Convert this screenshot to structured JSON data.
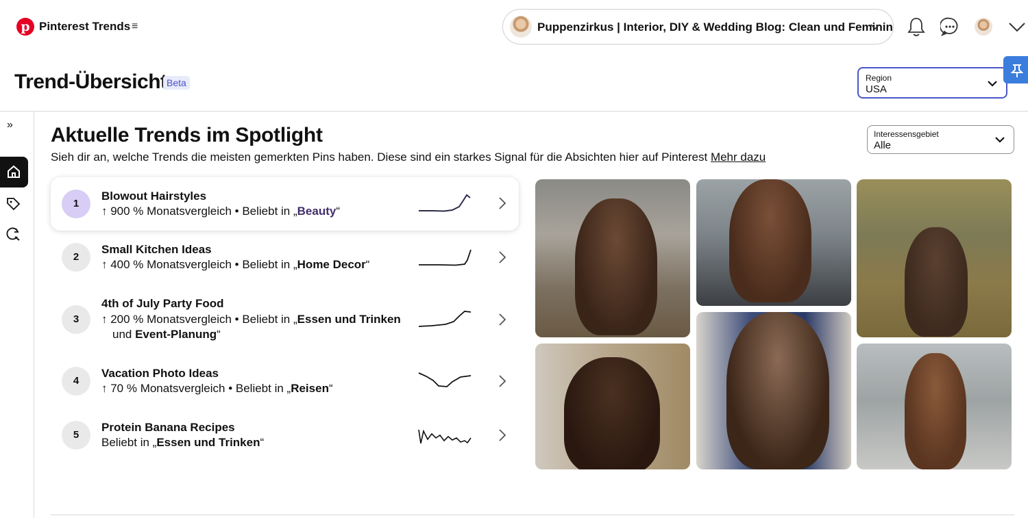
{
  "header": {
    "app_title": "Pinterest Trends",
    "logo_letter": "p",
    "menu_icon": "≡",
    "account_name": "Puppenzirkus | Interior, DIY & Wedding Blog: Clean und Feminin"
  },
  "page": {
    "title": "Trend-Übersicht",
    "badge": "Beta"
  },
  "region": {
    "label": "Region",
    "value": "USA"
  },
  "rail": {
    "expand_icon": "»"
  },
  "spotlight": {
    "title": "Aktuelle Trends im Spotlight",
    "subtitle": "Sieh dir an, welche Trends die meisten gemerkten Pins haben. Diese sind ein starkes Signal für die Absichten hier auf Pinterest",
    "link": "Mehr dazu"
  },
  "interest": {
    "label": "Interessensgebiet",
    "value": "Alle"
  },
  "trends": [
    {
      "rank": "1",
      "title": "Blowout Hairstyles",
      "meta_prefix": "↑ 900 % Monatsvergleich • Beliebt in „",
      "category": "Beauty",
      "meta_suffix": "“"
    },
    {
      "rank": "2",
      "title": "Small Kitchen Ideas",
      "meta_prefix": "↑ 400 % Monatsvergleich • Beliebt in „",
      "category": "Home Decor",
      "meta_suffix": "“"
    },
    {
      "rank": "3",
      "title": "4th of July Party Food",
      "meta_prefix": "↑ 200 % Monatsvergleich • Beliebt in „",
      "category": "Essen und Trinken",
      "meta_mid": "und ",
      "category2": "Event-Planung",
      "meta_suffix": "“"
    },
    {
      "rank": "4",
      "title": "Vacation Photo Ideas",
      "meta_prefix": "↑ 70 % Monatsvergleich • Beliebt in „",
      "category": "Reisen",
      "meta_suffix": "“"
    },
    {
      "rank": "5",
      "title": "Protein Banana Recipes",
      "meta_prefix": "Beliebt in „",
      "category": "Essen und Trinken",
      "meta_suffix": "“"
    }
  ],
  "colors": {
    "brand": "#e60023",
    "accent": "#4a55c8",
    "active_rank": "#d8cdf5"
  }
}
